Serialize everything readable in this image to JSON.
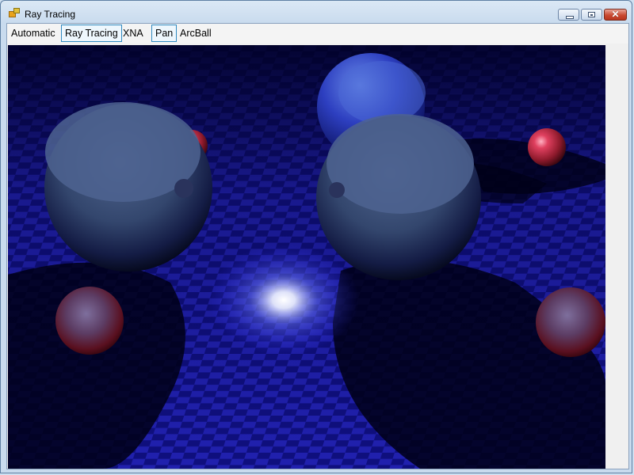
{
  "window": {
    "title": "Ray Tracing"
  },
  "menu": {
    "items": [
      {
        "label": "Automatic",
        "checked": false
      },
      {
        "label": "Ray Tracing",
        "checked": true
      },
      {
        "label": "XNA",
        "checked": false
      },
      {
        "label": "Pan",
        "checked": true
      },
      {
        "label": "ArcBall",
        "checked": false
      }
    ]
  },
  "scene": {
    "description_icons": [
      "app-icon",
      "minimize-icon",
      "maximize-icon",
      "close-icon"
    ],
    "floor_colors": [
      "#1a1ab8",
      "#0d0d6e"
    ],
    "sphere_colors": {
      "mirror": "#3a4f7a",
      "red": "#b3263c",
      "light": "#ffffff"
    }
  }
}
